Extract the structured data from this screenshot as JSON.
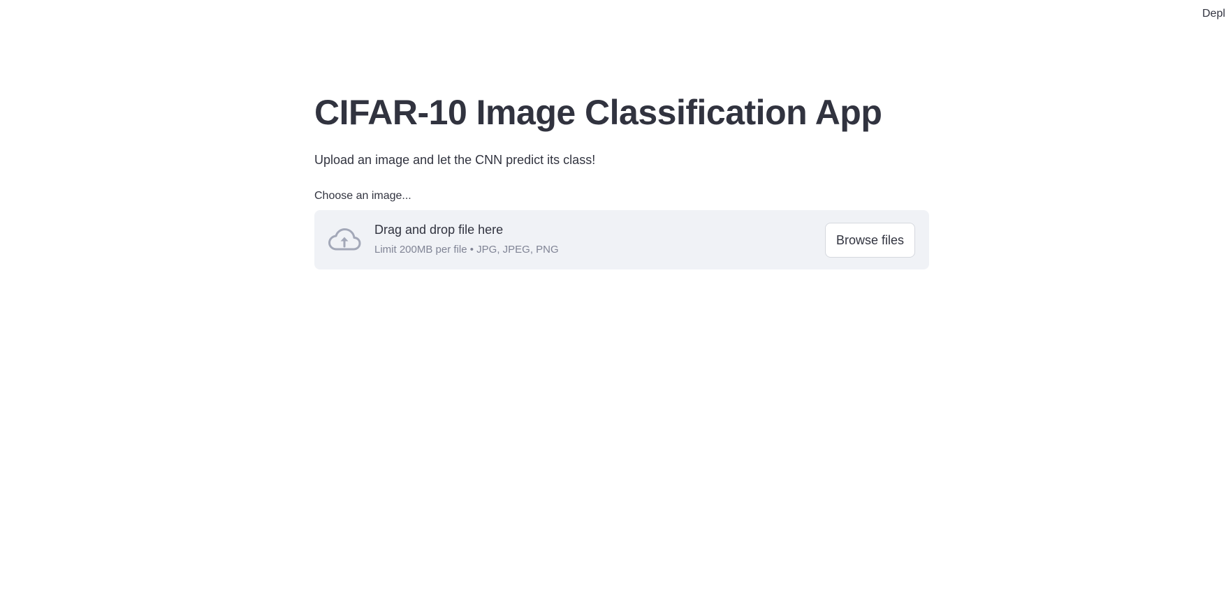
{
  "header": {
    "deploy_label": "Depl"
  },
  "main": {
    "title": "CIFAR-10 Image Classification App",
    "subtitle": "Upload an image and let the CNN predict its class!"
  },
  "uploader": {
    "label": "Choose an image...",
    "drop_text": "Drag and drop file here",
    "limit_text": "Limit 200MB per file • JPG, JPEG, PNG",
    "browse_label": "Browse files",
    "icon": "cloud-upload-icon"
  },
  "colors": {
    "text": "#31333f",
    "muted_text": "#808495",
    "dropzone_bg": "#f0f2f6",
    "icon": "#a3a8b8"
  }
}
